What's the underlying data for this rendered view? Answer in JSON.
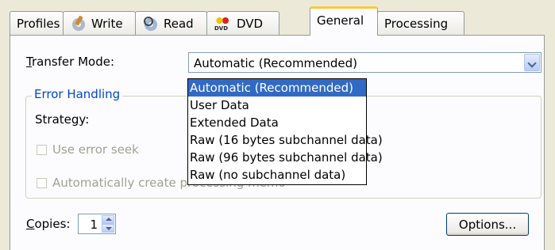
{
  "tabs": [
    {
      "label": "Profiles",
      "icon": "",
      "active": false
    },
    {
      "label": "Write",
      "icon": "write-disc-icon",
      "active": false
    },
    {
      "label": "Read",
      "icon": "read-disc-icon",
      "active": false
    },
    {
      "label": "DVD",
      "icon": "dvd-icon",
      "active": false
    },
    {
      "label": "General",
      "icon": "",
      "active": true
    },
    {
      "label": "Processing",
      "icon": "",
      "active": false
    }
  ],
  "transfer_mode": {
    "label_prefix": "T",
    "label_rest": "ransfer Mode:",
    "value": "Automatic (Recommended)",
    "options": [
      "Automatic (Recommended)",
      "User Data",
      "Extended Data",
      "Raw (16 bytes subchannel data)",
      "Raw (96 bytes subchannel data)",
      "Raw (no subchannel data)"
    ],
    "selected_index": 0
  },
  "error_handling": {
    "title": "Error Handling",
    "strategy_label_a": "Strate",
    "strategy_label_u": "g",
    "strategy_label_b": "y:",
    "use_error_seek": "Use error seek",
    "auto_create_memo": "Automatically create processing memo"
  },
  "copies": {
    "label_prefix": "C",
    "label_rest": "opies:",
    "value": "1"
  },
  "options_button": "Options...",
  "colors": {
    "accent": "#316ac5",
    "group_title": "#0046d5",
    "tab_highlight": "#ffc83c",
    "background": "#ece9d8"
  }
}
